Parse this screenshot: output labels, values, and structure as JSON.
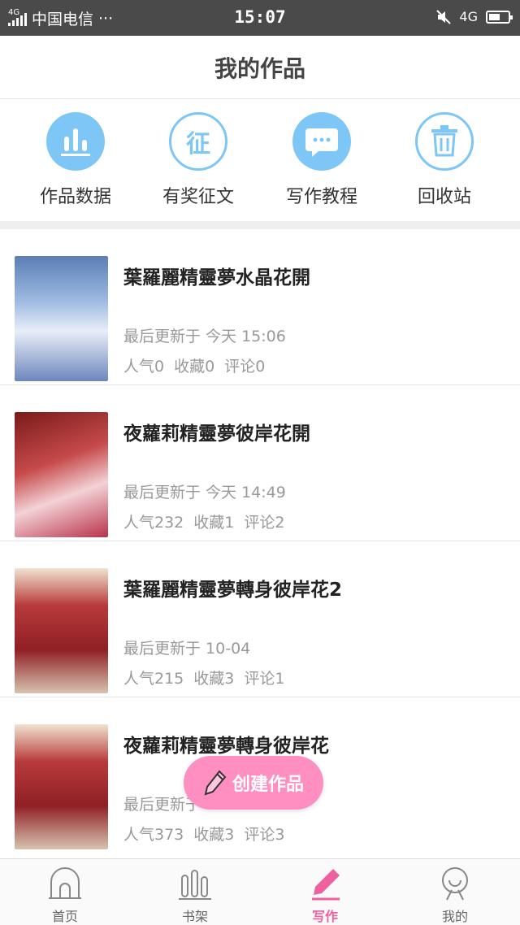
{
  "status_bar": {
    "network_small": "4G",
    "carrier": "中国电信",
    "more": "···",
    "time": "15:07",
    "network": "4G"
  },
  "header": {
    "title": "我的作品"
  },
  "quick_actions": [
    {
      "label": "作品数据",
      "icon": "bar-chart-icon"
    },
    {
      "label": "有奖征文",
      "icon": "zheng-badge-icon",
      "glyph": "征"
    },
    {
      "label": "写作教程",
      "icon": "chat-bubble-icon"
    },
    {
      "label": "回收站",
      "icon": "trash-icon"
    }
  ],
  "works": [
    {
      "title": "葉羅麗精靈夢水晶花開",
      "updated": "最后更新于  今天  15:06",
      "popularity": "人气0",
      "favorites": "收藏0",
      "comments": "评论0"
    },
    {
      "title": "夜蘿莉精靈夢彼岸花開",
      "updated": "最后更新于  今天  14:49",
      "popularity": "人气232",
      "favorites": "收藏1",
      "comments": "评论2"
    },
    {
      "title": "葉羅麗精靈夢轉身彼岸花2",
      "updated": "最后更新于  10-04",
      "popularity": "人气215",
      "favorites": "收藏3",
      "comments": "评论1"
    },
    {
      "title": "夜蘿莉精靈夢轉身彼岸花",
      "updated": "最后更新于",
      "popularity": "人气373",
      "favorites": "收藏3",
      "comments": "评论3"
    }
  ],
  "create_button": {
    "label": "创建作品"
  },
  "tabs": [
    {
      "label": "首页",
      "icon": "home-icon",
      "active": false
    },
    {
      "label": "书架",
      "icon": "bookshelf-icon",
      "active": false
    },
    {
      "label": "写作",
      "icon": "pencil-icon",
      "active": true
    },
    {
      "label": "我的",
      "icon": "profile-icon",
      "active": false
    }
  ],
  "colors": {
    "accent_blue": "#7dc6f5",
    "accent_pink": "#ff8fc1",
    "active_tab": "#f0609e",
    "meta_gray": "#999999"
  }
}
